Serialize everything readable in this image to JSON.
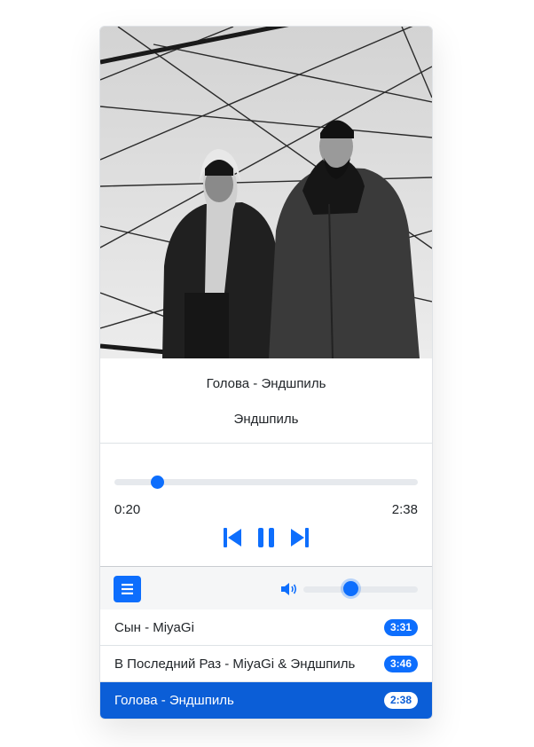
{
  "player": {
    "now_playing": {
      "title": "Голова - Эндшпиль",
      "artist": "Эндшпиль"
    },
    "progress": {
      "current": "0:20",
      "total": "2:38",
      "fraction": 0.14
    },
    "volume": {
      "fraction": 0.42
    },
    "playlist": [
      {
        "label": "Сын - MiyaGi",
        "duration": "3:31"
      },
      {
        "label": "В Последний Раз - MiyaGi & Эндшпиль",
        "duration": "3:46"
      },
      {
        "label": "Голова - Эндшпиль",
        "duration": "2:38",
        "active": true
      }
    ],
    "icons": {
      "prev": "skip-previous-icon",
      "pause": "pause-icon",
      "next": "skip-next-icon",
      "menu": "list-icon",
      "volume": "volume-icon"
    },
    "colors": {
      "accent": "#0d6efd",
      "active_row": "#0b5ed7"
    }
  }
}
